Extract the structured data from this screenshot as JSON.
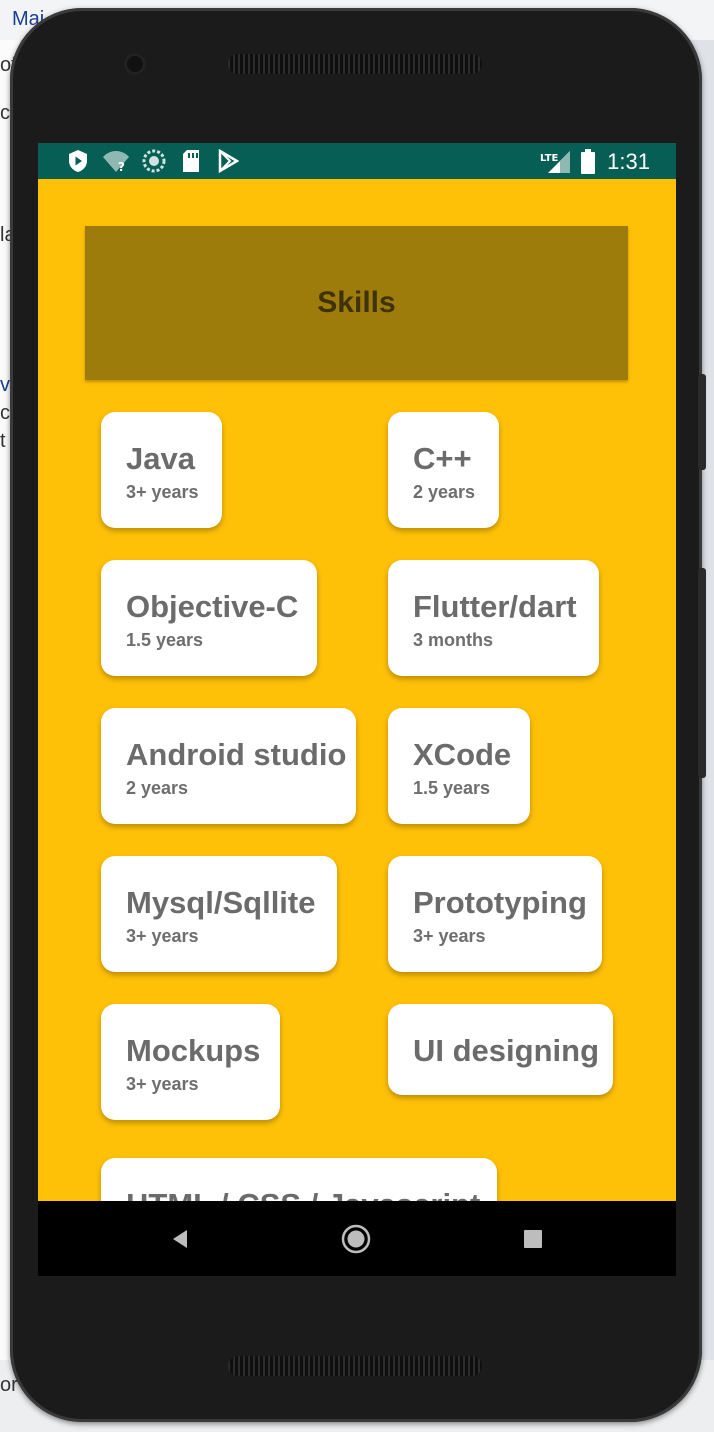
{
  "background": {
    "top_text": "Mai",
    "left_fragments": [
      "of",
      "c",
      "la",
      "v",
      "c",
      "t"
    ],
    "bottom_fragment": "or"
  },
  "status_bar": {
    "time": "1:31",
    "network": "LTE",
    "icons": [
      "play-protect-icon",
      "wifi-question-icon",
      "sync-circle-icon",
      "sd-card-icon",
      "play-store-icon",
      "lte-signal-icon",
      "battery-icon"
    ],
    "color": "#075e54"
  },
  "header": {
    "title": "Skills",
    "color": "#9e7c0c"
  },
  "skills": [
    {
      "name": "Java",
      "experience": "3+ years"
    },
    {
      "name": "C++",
      "experience": "2 years"
    },
    {
      "name": "Objective-C",
      "experience": "1.5 years"
    },
    {
      "name": "Flutter/dart",
      "experience": "3 months"
    },
    {
      "name": "Android studio",
      "experience": "2 years"
    },
    {
      "name": "XCode",
      "experience": "1.5 years"
    },
    {
      "name": "Mysql/Sqllite",
      "experience": "3+ years"
    },
    {
      "name": "Prototyping",
      "experience": "3+ years"
    },
    {
      "name": "Mockups",
      "experience": "3+ years"
    },
    {
      "name": "UI designing",
      "experience": ""
    },
    {
      "name": "HTML / CSS / Javascript",
      "experience": ""
    }
  ],
  "colors": {
    "screen_bg": "#ffc107",
    "card_bg": "#ffffff",
    "card_text": "#6b6b6b"
  },
  "nav_bar": {
    "buttons": [
      "back-icon",
      "home-icon",
      "recents-icon"
    ]
  }
}
